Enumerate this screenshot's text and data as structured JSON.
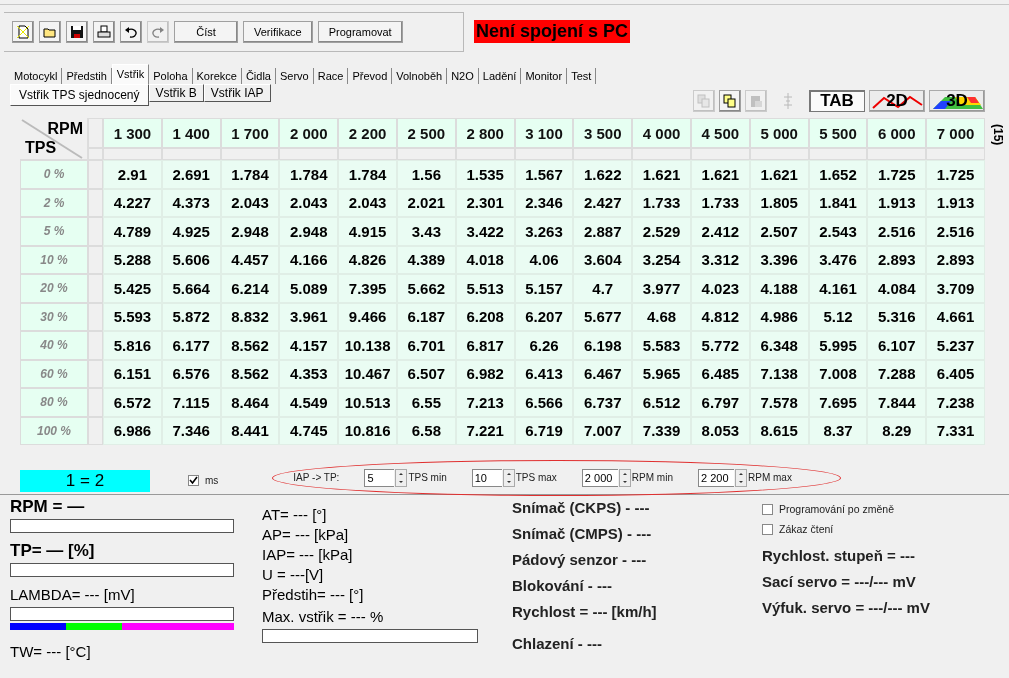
{
  "toolbar": {
    "icon_buttons": [
      {
        "kind": "new",
        "disabled": false
      },
      {
        "kind": "open",
        "disabled": false
      },
      {
        "kind": "save",
        "disabled": false
      },
      {
        "kind": "print",
        "disabled": false
      },
      {
        "kind": "undo",
        "disabled": false
      },
      {
        "kind": "redo",
        "disabled": true
      }
    ],
    "buttons": [
      "Číst",
      "Verifikace",
      "Programovat"
    ],
    "status": "Není spojení s PC"
  },
  "tabs": [
    {
      "label": "Motocykl",
      "selected": false
    },
    {
      "label": "Předstih",
      "selected": false
    },
    {
      "label": "Vstřik",
      "selected": true
    },
    {
      "label": "Poloha",
      "selected": false
    },
    {
      "label": "Korekce",
      "selected": false
    },
    {
      "label": "Čidla",
      "selected": false
    },
    {
      "label": "Servo",
      "selected": false
    },
    {
      "label": "Race",
      "selected": false
    },
    {
      "label": "Převod",
      "selected": false
    },
    {
      "label": "Volnoběh",
      "selected": false
    },
    {
      "label": "N2O",
      "selected": false
    },
    {
      "label": "Ladění",
      "selected": false
    },
    {
      "label": "Monitor",
      "selected": false
    },
    {
      "label": "Test",
      "selected": false
    }
  ],
  "subtabs": [
    {
      "label": "Vstřik TPS sjednocený",
      "selected": true
    },
    {
      "label": "Vstřik B",
      "selected": false
    },
    {
      "label": "Vstřik IAP",
      "selected": false
    }
  ],
  "view_tools": [
    {
      "kind": "copy",
      "disabled": true
    },
    {
      "kind": "paste-special",
      "disabled": false
    },
    {
      "kind": "paste",
      "disabled": true
    },
    {
      "kind": "axis",
      "disabled": true
    }
  ],
  "view_modes": [
    {
      "label": "TAB",
      "kind": "table",
      "selected": true
    },
    {
      "label": "2D",
      "kind": "line",
      "selected": false
    },
    {
      "label": "3D",
      "kind": "surface",
      "selected": false
    }
  ],
  "table": {
    "corner_x": "RPM",
    "corner_y": "TPS",
    "side_label": "(15)",
    "columns": [
      "1 300",
      "1 400",
      "1 700",
      "2 000",
      "2 200",
      "2 500",
      "2 800",
      "3 100",
      "3 500",
      "4 000",
      "4 500",
      "5 000",
      "5 500",
      "6 000",
      "7 000"
    ],
    "rows": [
      {
        "label": "0 %",
        "values": [
          "2.91",
          "2.691",
          "1.784",
          "1.784",
          "1.784",
          "1.56",
          "1.535",
          "1.567",
          "1.622",
          "1.621",
          "1.621",
          "1.621",
          "1.652",
          "1.725",
          "1.725"
        ]
      },
      {
        "label": "2 %",
        "values": [
          "4.227",
          "4.373",
          "2.043",
          "2.043",
          "2.043",
          "2.021",
          "2.301",
          "2.346",
          "2.427",
          "1.733",
          "1.733",
          "1.805",
          "1.841",
          "1.913",
          "1.913"
        ]
      },
      {
        "label": "5 %",
        "values": [
          "4.789",
          "4.925",
          "2.948",
          "2.948",
          "4.915",
          "3.43",
          "3.422",
          "3.263",
          "2.887",
          "2.529",
          "2.412",
          "2.507",
          "2.543",
          "2.516",
          "2.516"
        ]
      },
      {
        "label": "10 %",
        "values": [
          "5.288",
          "5.606",
          "4.457",
          "4.166",
          "4.826",
          "4.389",
          "4.018",
          "4.06",
          "3.604",
          "3.254",
          "3.312",
          "3.396",
          "3.476",
          "2.893",
          "2.893"
        ]
      },
      {
        "label": "20 %",
        "values": [
          "5.425",
          "5.664",
          "6.214",
          "5.089",
          "7.395",
          "5.662",
          "5.513",
          "5.157",
          "4.7",
          "3.977",
          "4.023",
          "4.188",
          "4.161",
          "4.084",
          "3.709"
        ]
      },
      {
        "label": "30 %",
        "values": [
          "5.593",
          "5.872",
          "8.832",
          "3.961",
          "9.466",
          "6.187",
          "6.208",
          "6.207",
          "5.677",
          "4.68",
          "4.812",
          "4.986",
          "5.12",
          "5.316",
          "4.661"
        ]
      },
      {
        "label": "40 %",
        "values": [
          "5.816",
          "6.177",
          "8.562",
          "4.157",
          "10.138",
          "6.701",
          "6.817",
          "6.26",
          "6.198",
          "5.583",
          "5.772",
          "6.348",
          "5.995",
          "6.107",
          "5.237"
        ]
      },
      {
        "label": "60 %",
        "values": [
          "6.151",
          "6.576",
          "8.562",
          "4.353",
          "10.467",
          "6.507",
          "6.982",
          "6.413",
          "6.467",
          "5.965",
          "6.485",
          "7.138",
          "7.008",
          "7.288",
          "6.405"
        ]
      },
      {
        "label": "80 %",
        "values": [
          "6.572",
          "7.115",
          "8.464",
          "4.549",
          "10.513",
          "6.55",
          "7.213",
          "6.566",
          "6.737",
          "6.512",
          "6.797",
          "7.578",
          "7.695",
          "7.844",
          "7.238"
        ]
      },
      {
        "label": "100 %",
        "values": [
          "6.986",
          "7.346",
          "8.441",
          "4.745",
          "10.816",
          "6.58",
          "7.221",
          "6.719",
          "7.007",
          "7.339",
          "8.053",
          "8.615",
          "8.37",
          "8.29",
          "7.331"
        ]
      }
    ]
  },
  "controls": {
    "ratio": "1 = 2",
    "ms": {
      "label": "ms",
      "checked": true
    },
    "iap_label": "IAP -> TP:",
    "spinners": [
      {
        "value": "5",
        "label": "TPS min"
      },
      {
        "value": "10",
        "label": "TPS max"
      },
      {
        "value": "2 000",
        "label": "RPM min"
      },
      {
        "value": "2 200",
        "label": "RPM max"
      }
    ]
  },
  "readouts": {
    "left": [
      {
        "kind": "large-gauge",
        "text": "RPM = —"
      },
      {
        "kind": "large-gauge",
        "text": "TP= — [%]"
      },
      {
        "kind": "lambda-gauge",
        "text": "LAMBDA= --- [mV]"
      },
      {
        "kind": "text",
        "text": "TW= --- [°C]"
      }
    ],
    "middle": [
      {
        "kind": "text",
        "text": "AT= --- [°]"
      },
      {
        "kind": "text",
        "text": "AP= --- [kPa]"
      },
      {
        "kind": "text",
        "text": "IAP= --- [kPa]"
      },
      {
        "kind": "text",
        "text": "U = ---[V]"
      },
      {
        "kind": "text",
        "text": "Předstih= --- [°]"
      },
      {
        "kind": "gauge",
        "text": "Max. vstřik = --- %"
      }
    ],
    "sensors": [
      "Snímač (CKPS) - ---",
      "Snímač (CMPS) - ---",
      "Pádový senzor - ---",
      "Blokování  - ---",
      "Rychlost = --- [km/h]",
      "Chlazení - ---"
    ],
    "options": [
      {
        "label": "Programování po změně",
        "checked": false
      },
      {
        "label": "Zákaz čtení",
        "checked": false
      }
    ],
    "status": [
      "Rychlost. stupeň = ---",
      "Sací servo  = ---/--- mV",
      "Výfuk. servo  = ---/--- mV"
    ]
  }
}
